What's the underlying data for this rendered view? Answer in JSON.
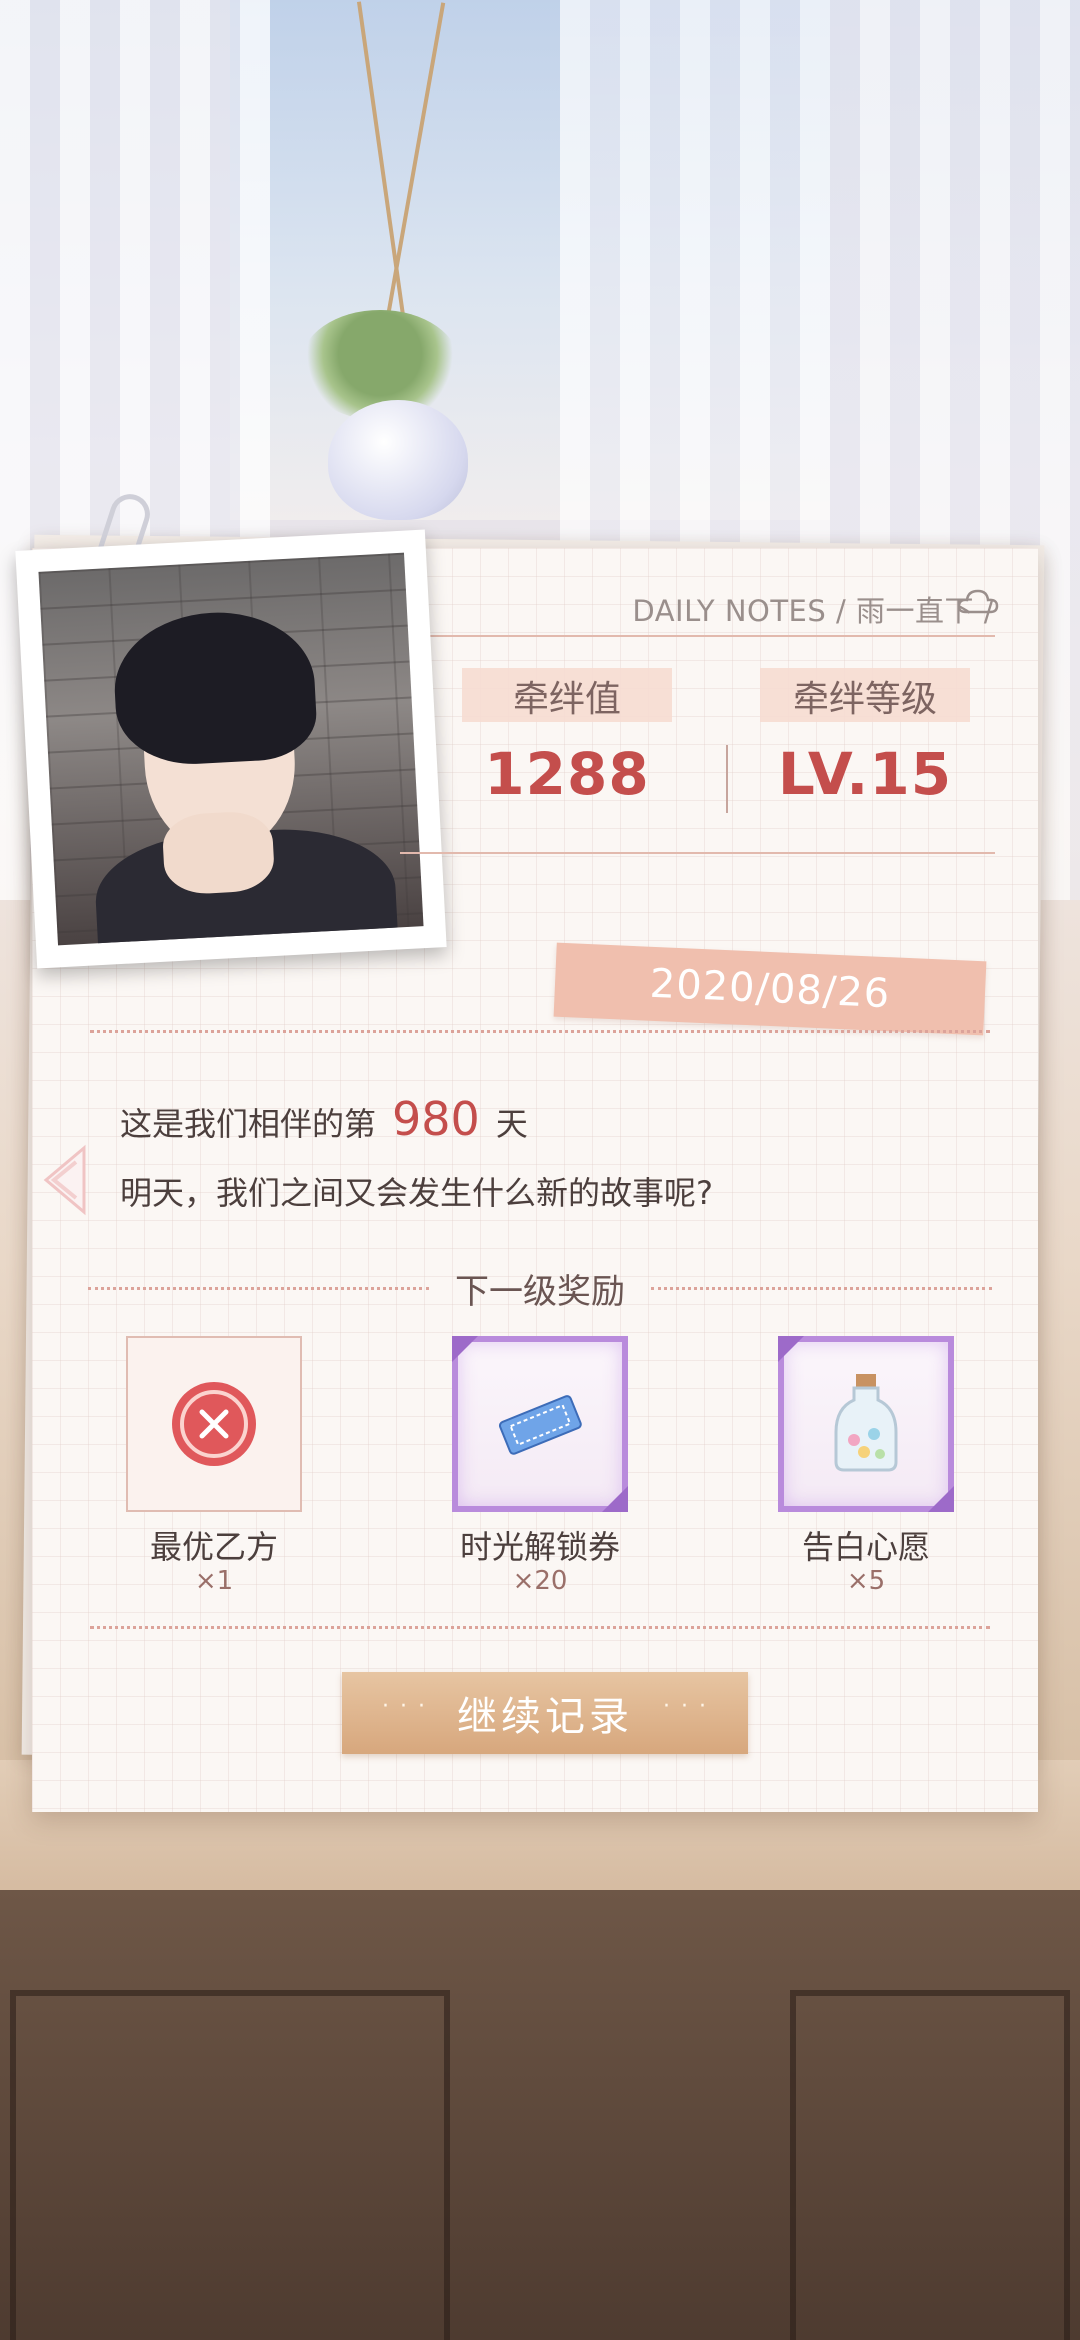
{
  "header": {
    "title": "DAILY NOTES / 雨一直下 /",
    "weather_icon": "cloud-icon"
  },
  "stats": {
    "bond_value_label": "牵绊值",
    "bond_value": "1288",
    "bond_level_label": "牵绊等级",
    "bond_level": "LV.15"
  },
  "date": "2020/08/26",
  "message": {
    "line1_prefix": "这是我们相伴的第",
    "days": "980",
    "line1_suffix": "天",
    "line2": "明天，我们之间又会发生什么新的故事呢?"
  },
  "rewards": {
    "title": "下一级奖励",
    "items": [
      {
        "name": "最优乙方",
        "count": "×1",
        "icon": "x-badge-icon"
      },
      {
        "name": "时光解锁券",
        "count": "×20",
        "icon": "ticket-icon"
      },
      {
        "name": "告白心愿",
        "count": "×5",
        "icon": "wish-bottle-icon"
      }
    ]
  },
  "continue_button": "继续记录",
  "colors": {
    "accent": "#c44e4c",
    "tag": "#f0bfae",
    "button": "#d7a77d",
    "rare_frame": "#b98bdc"
  }
}
